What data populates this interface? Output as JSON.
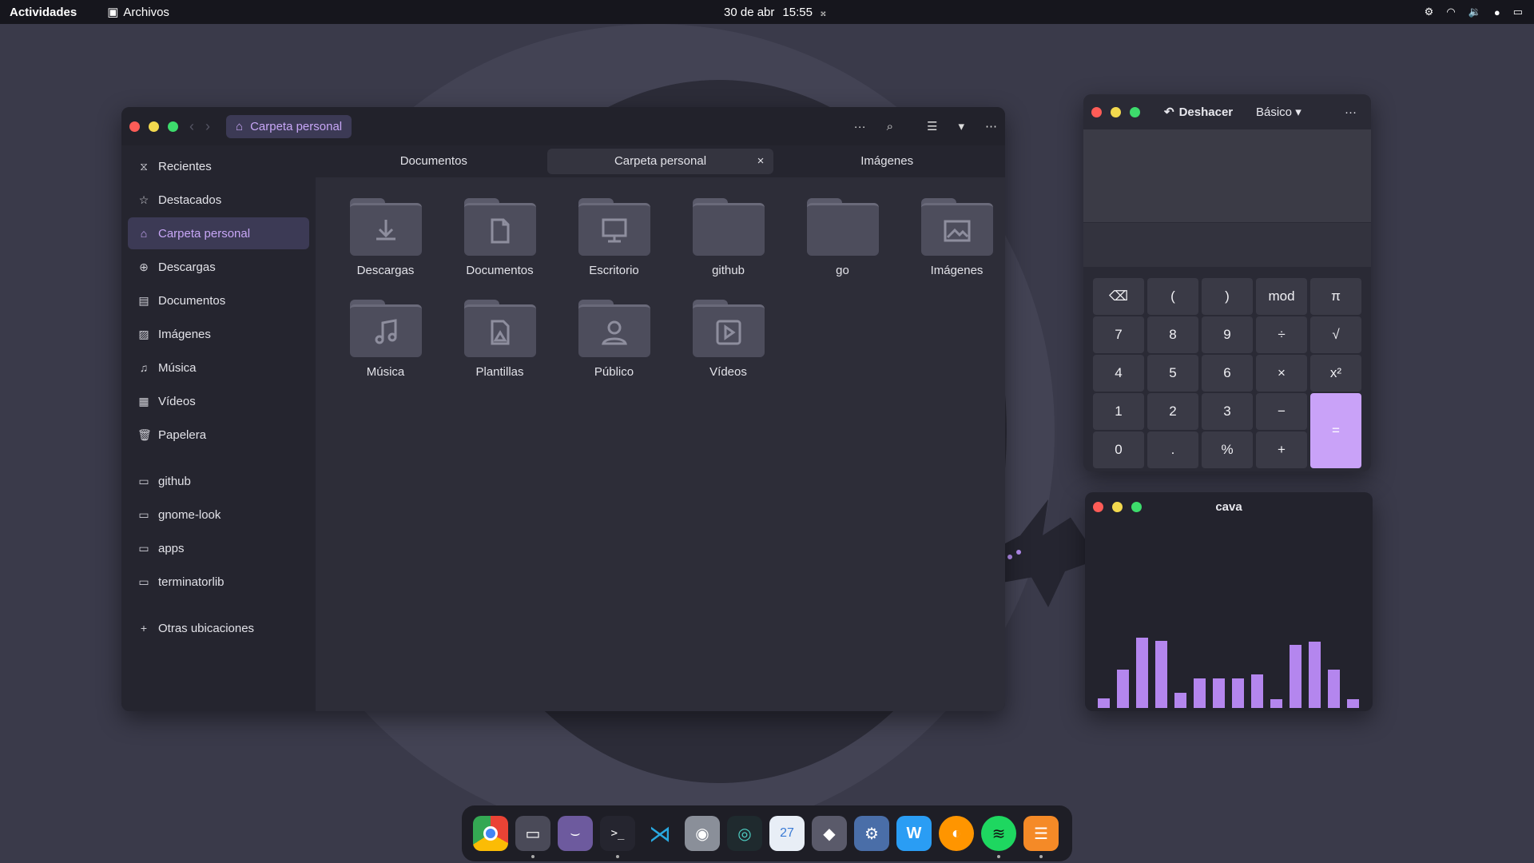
{
  "topbar": {
    "activities": "Actividades",
    "app_name": "Archivos",
    "date": "30 de abr",
    "time": "15:55"
  },
  "files": {
    "breadcrumb": "Carpeta personal",
    "sidebar": [
      {
        "label": "Recientes",
        "icon": "clock-icon"
      },
      {
        "label": "Destacados",
        "icon": "star-icon"
      },
      {
        "label": "Carpeta personal",
        "icon": "home-icon"
      },
      {
        "label": "Descargas",
        "icon": "download-icon"
      },
      {
        "label": "Documentos",
        "icon": "document-icon"
      },
      {
        "label": "Imágenes",
        "icon": "image-icon"
      },
      {
        "label": "Música",
        "icon": "music-icon"
      },
      {
        "label": "Vídeos",
        "icon": "film-icon"
      },
      {
        "label": "Papelera",
        "icon": "trash-icon"
      }
    ],
    "bookmarks": [
      "github",
      "gnome-look",
      "apps",
      "terminatorlib"
    ],
    "other_locations": "Otras ubicaciones",
    "tabs": [
      "Documentos",
      "Carpeta personal",
      "Imágenes"
    ],
    "items": [
      "Descargas",
      "Documentos",
      "Escritorio",
      "github",
      "go",
      "Imágenes",
      "Música",
      "Plantillas",
      "Público",
      "Vídeos"
    ]
  },
  "calculator": {
    "undo_label": "Deshacer",
    "mode": "Básico",
    "keys": [
      "⌫",
      "(",
      ")",
      "mod",
      "π",
      "7",
      "8",
      "9",
      "÷",
      "√",
      "4",
      "5",
      "6",
      "×",
      "x²",
      "1",
      "2",
      "3",
      "−",
      "=",
      "0",
      ".",
      "%",
      "+"
    ]
  },
  "cava": {
    "title": "cava",
    "levels": [
      0.07,
      0.27,
      0.5,
      0.48,
      0.11,
      0.21,
      0.21,
      0.21,
      0.24,
      0.06,
      0.45,
      0.47,
      0.27,
      0.06
    ]
  },
  "colors": {
    "accent": "#c9a2f8",
    "bar": "#b486ee"
  }
}
